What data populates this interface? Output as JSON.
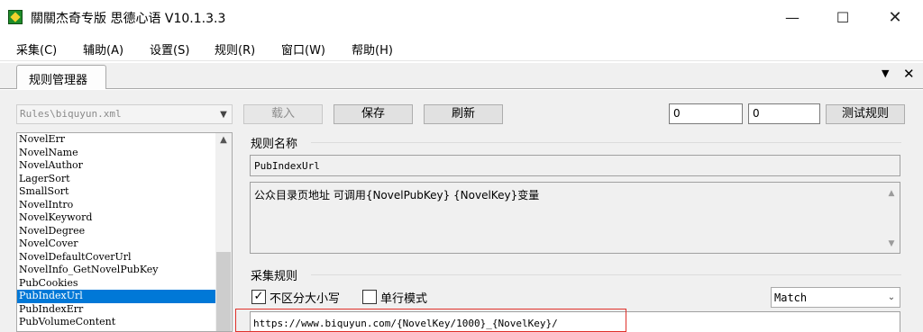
{
  "window": {
    "title": "關關杰奇专版 思德心语 V10.1.3.3",
    "minimize": "—",
    "maximize": "☐",
    "close": "✕"
  },
  "menu": [
    "采集(C)",
    "辅助(A)",
    "设置(S)",
    "规则(R)",
    "窗口(W)",
    "帮助(H)"
  ],
  "tab": {
    "label": "规则管理器",
    "menu_glyph": "▼",
    "close_glyph": "✕"
  },
  "toolbar": {
    "rules_file": "Rules\\biquyun.xml",
    "load_label": "载入",
    "save_label": "保存",
    "refresh_label": "刷新",
    "field1": "0",
    "field2": "0",
    "test_label": "测试规则"
  },
  "rule_list": {
    "items": [
      "NovelErr",
      "NovelName",
      "NovelAuthor",
      "LagerSort",
      "SmallSort",
      "NovelIntro",
      "NovelKeyword",
      "NovelDegree",
      "NovelCover",
      "NovelDefaultCoverUrl",
      "NovelInfo_GetNovelPubKey",
      "PubCookies",
      "PubIndexUrl",
      "PubIndexErr",
      "PubVolumeContent"
    ],
    "selected": "PubIndexUrl"
  },
  "rule_name": {
    "label": "规则名称",
    "value": "PubIndexUrl",
    "description": "公众目录页地址 可调用{NovelPubKey} {NovelKey}变量"
  },
  "collect_rule": {
    "label": "采集规则",
    "ignore_case": {
      "label": "不区分大小写",
      "checked": true,
      "mark": "✓"
    },
    "single_line": {
      "label": "单行模式",
      "checked": false
    },
    "mode": "Match",
    "pattern": "https://www.biquyun.com/{NovelKey/1000}_{NovelKey}/"
  },
  "colors": {
    "selection": "#0078d7",
    "highlight_border": "#e0302a",
    "panel_bg": "#f0f0f0"
  }
}
